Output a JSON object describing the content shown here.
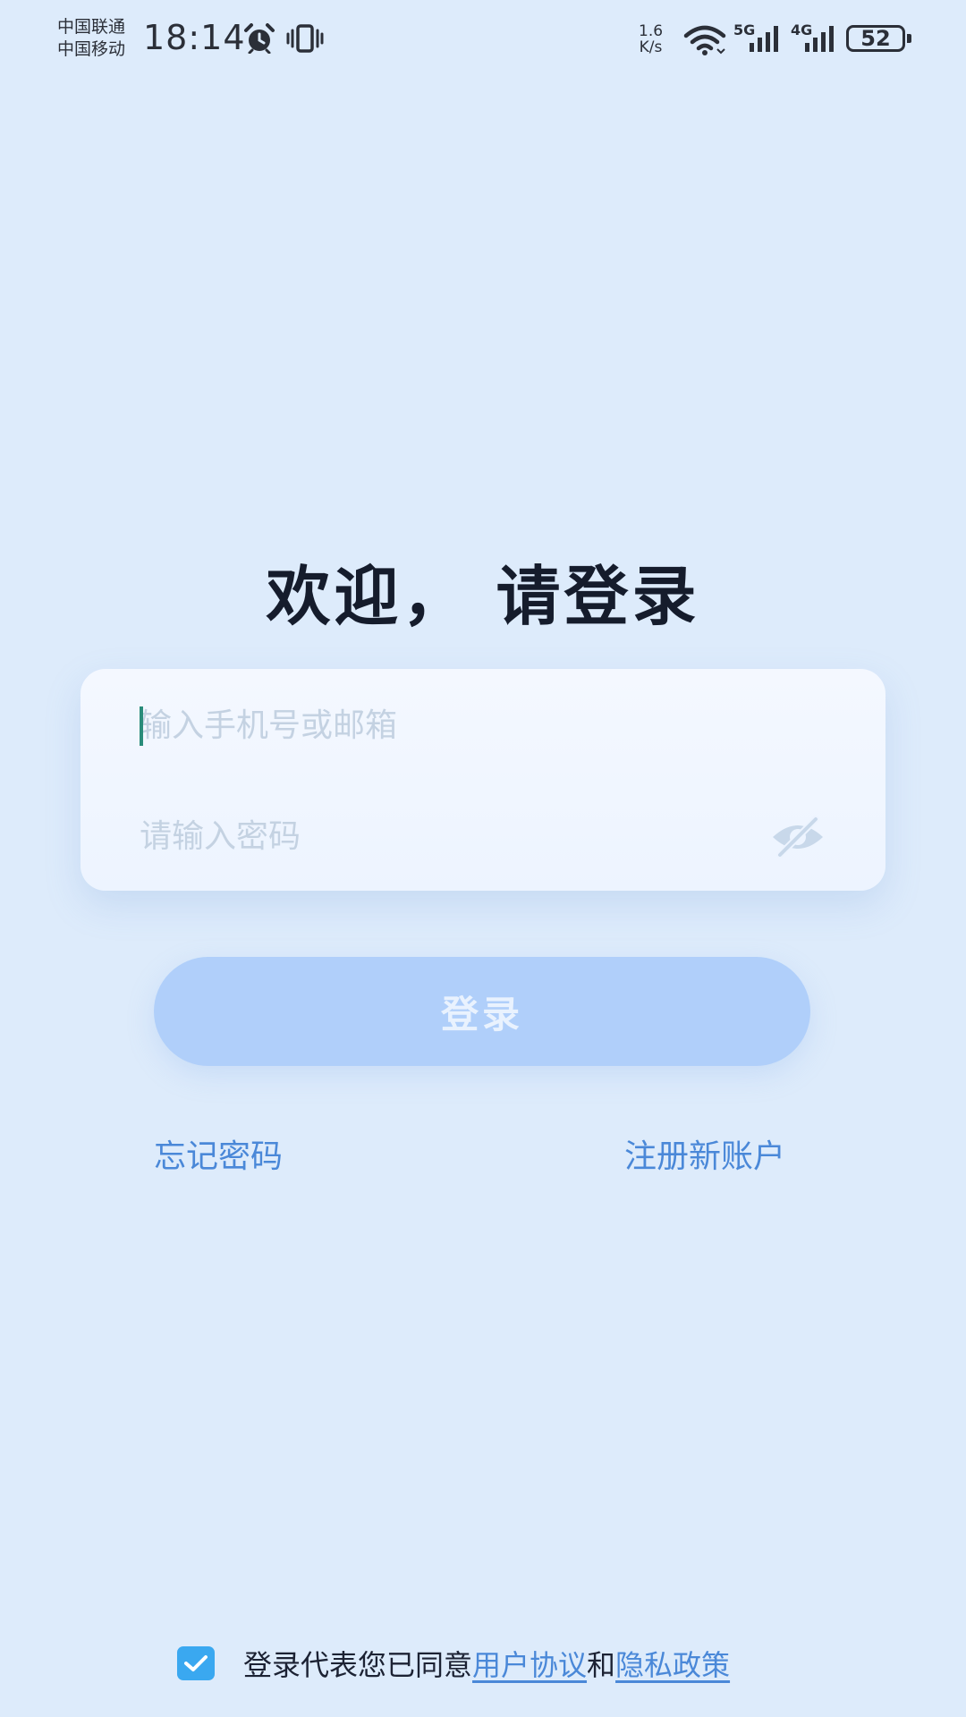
{
  "status_bar": {
    "carrier_1": "中国联通",
    "carrier_2": "中国移动",
    "time": "18:14",
    "net_speed_value": "1.6",
    "net_speed_unit": "K/s",
    "signal_1_label": "5G",
    "signal_2_label": "4G",
    "battery_level": "52",
    "icons": [
      "alarm-icon",
      "vibrate-icon",
      "wifi-icon",
      "signal-5g-icon",
      "signal-4g-icon",
      "battery-icon"
    ]
  },
  "login": {
    "title": "欢迎， 请登录",
    "account_placeholder": "输入手机号或邮箱",
    "account_value": "",
    "password_placeholder": "请输入密码",
    "password_value": "",
    "password_toggle_icon": "eye-off-icon",
    "submit_label": "登录",
    "forgot_label": "忘记密码",
    "register_label": "注册新账户"
  },
  "agreement": {
    "checked": true,
    "text": "登录代表您已同意",
    "user_agreement_label": "用户协议",
    "conjunction": "和",
    "privacy_policy_label": "隐私政策"
  },
  "colors": {
    "background": "#ddebfb",
    "accent": "#4a88d8",
    "button_disabled": "#b0cffa",
    "checkbox": "#3aa8f0"
  }
}
